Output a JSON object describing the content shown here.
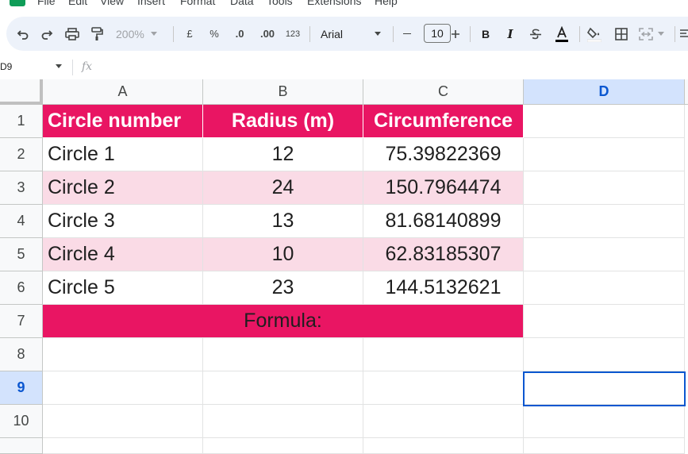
{
  "menu": [
    "File",
    "Edit",
    "View",
    "Insert",
    "Format",
    "Data",
    "Tools",
    "Extensions",
    "Help"
  ],
  "toolbar": {
    "zoom": "200%",
    "currency": "£",
    "percent": "%",
    "decrease_decimals": ".0",
    "increase_decimals": ".00",
    "number_format": "123",
    "font": "Arial",
    "font_size": "10",
    "bold": "B",
    "italic": "I"
  },
  "name_box": "D9",
  "fx_label": "fx",
  "columns": [
    "A",
    "B",
    "C",
    "D"
  ],
  "active_column": "D",
  "rows": [
    "1",
    "2",
    "3",
    "4",
    "5",
    "6",
    "7",
    "8",
    "9",
    "10"
  ],
  "active_row": "9",
  "header": {
    "col_a": "Circle number",
    "col_b": "Radius (m)",
    "col_c": "Circumference"
  },
  "data_rows": [
    {
      "name": "Circle 1",
      "radius": "12",
      "circumference": "75.39822369"
    },
    {
      "name": "Circle 2",
      "radius": "24",
      "circumference": "150.7964474"
    },
    {
      "name": "Circle 3",
      "radius": "13",
      "circumference": "81.68140899"
    },
    {
      "name": "Circle 4",
      "radius": "10",
      "circumference": "62.83185307"
    },
    {
      "name": "Circle 5",
      "radius": "23",
      "circumference": "144.5132621"
    }
  ],
  "formula_label": "Formula:",
  "colors": {
    "header_fill": "#e91563",
    "band_fill": "#fadbe6",
    "selection": "#0b57d0"
  }
}
